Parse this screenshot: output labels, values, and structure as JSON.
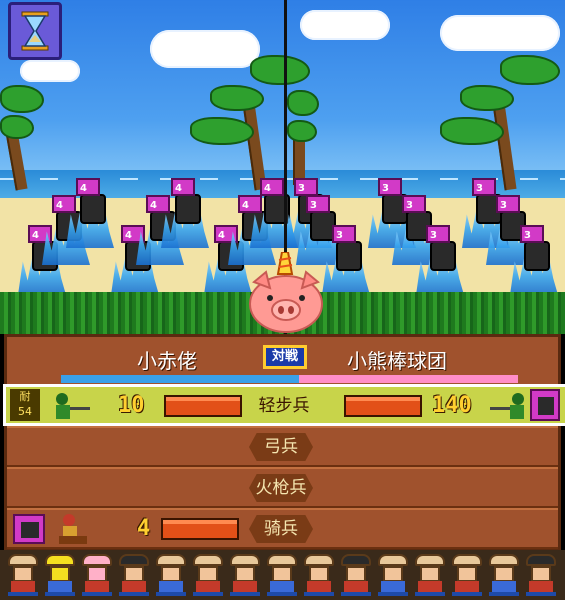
{
  "battle": {
    "vs_badge": "対戦",
    "left_team": "小赤佬",
    "right_team": "小熊棒球团",
    "left_strength": 0.52,
    "right_strength": 0.48
  },
  "scene": {
    "left_unit_badge": "4",
    "right_unit_badge": "3"
  },
  "infantry_row": {
    "side_label_top": "耐",
    "side_label_bottom": "54",
    "label": "轻步兵",
    "left_count": "10",
    "right_count": "140",
    "left_bar_fill": 1.0,
    "right_bar_fill": 1.0
  },
  "archer_row": {
    "label": "弓兵"
  },
  "musket_row": {
    "label": "火枪兵"
  },
  "cavalry_row": {
    "label": "骑兵",
    "left_count": "4",
    "left_bar_fill": 1.0
  },
  "roster_count": 15,
  "colors": {
    "panel": "#a0522d",
    "highlight_row": "#c8d44a",
    "bar": "#e25018",
    "left_health": "#3aa0e8",
    "right_health": "#ff8ec8"
  },
  "icons": {
    "hourglass": "hourglass-icon",
    "pig_mascot": "pig-mascot-icon"
  }
}
